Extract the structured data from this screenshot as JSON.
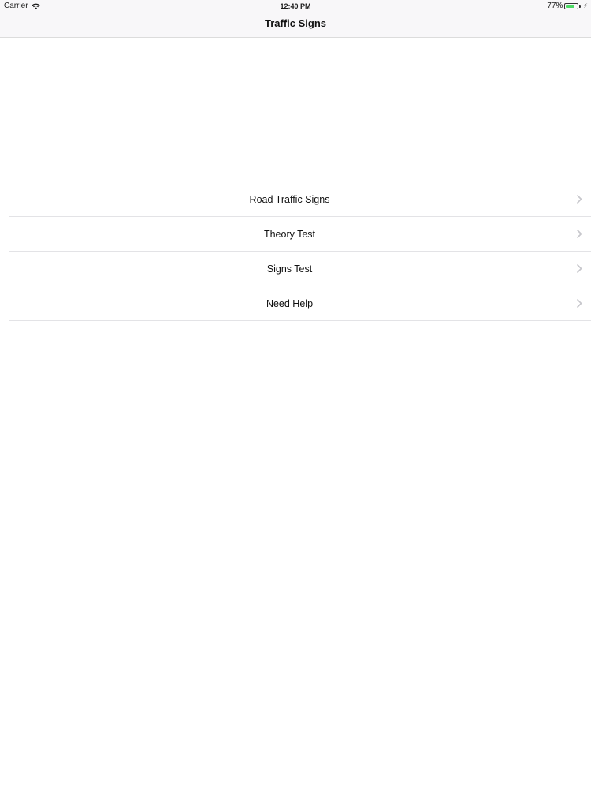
{
  "status_bar": {
    "carrier": "Carrier",
    "time": "12:40 PM",
    "battery_percent": "77%",
    "battery_level": 0.77,
    "battery_color": "#4cd964"
  },
  "nav": {
    "title": "Traffic Signs"
  },
  "menu": {
    "items": [
      {
        "label": "Road Traffic Signs",
        "icon": "chevron-right-icon"
      },
      {
        "label": "Theory Test",
        "icon": "chevron-right-icon"
      },
      {
        "label": "Signs Test",
        "icon": "chevron-right-icon"
      },
      {
        "label": "Need Help",
        "icon": "chevron-right-icon"
      }
    ]
  }
}
